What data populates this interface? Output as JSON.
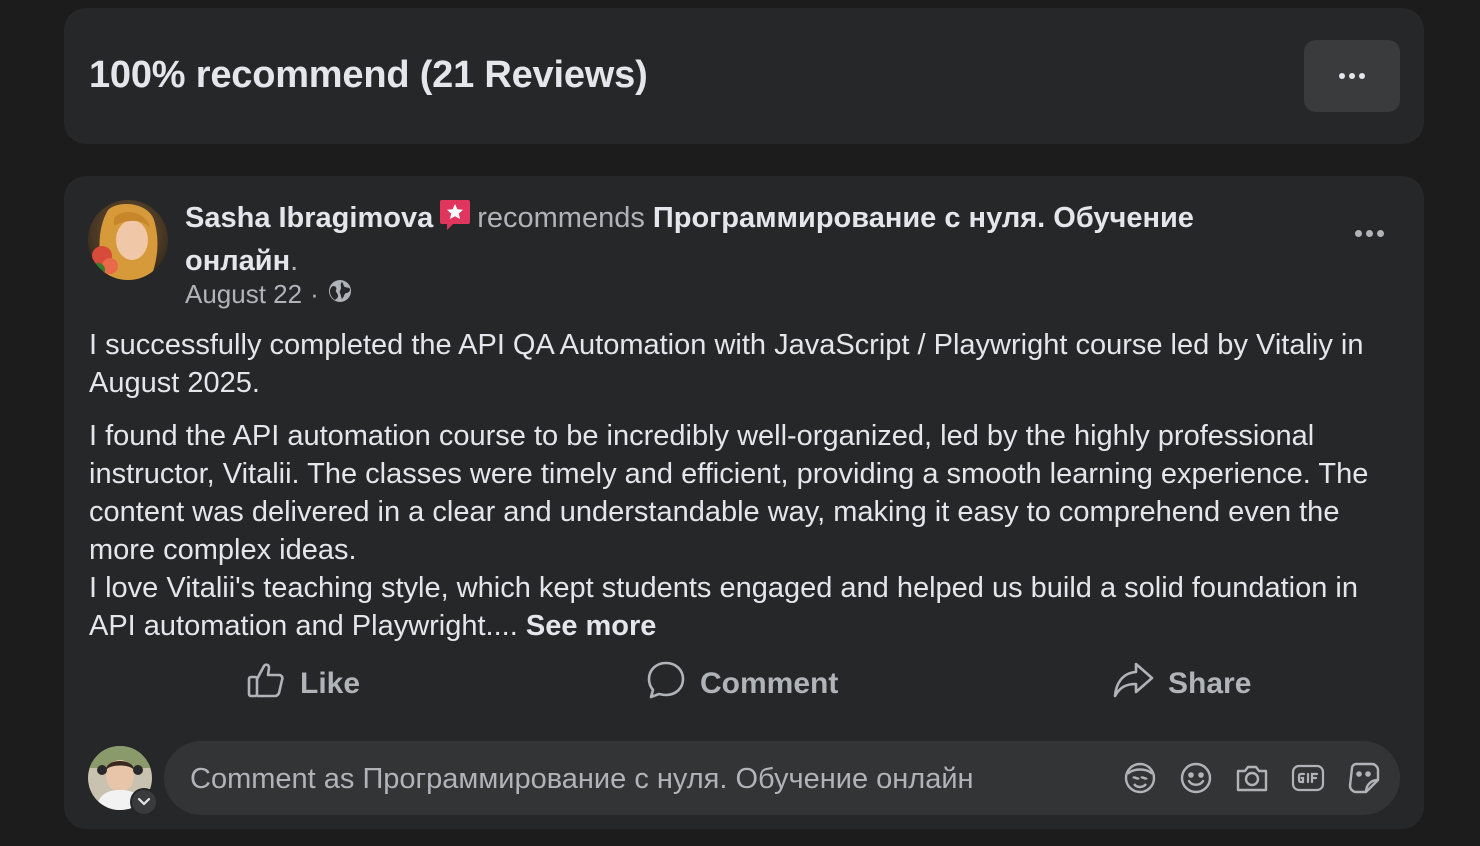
{
  "header": {
    "title": "100% recommend (21 Reviews)",
    "more_icon": "more-horizontal-icon"
  },
  "review": {
    "author": "Sasha Ibragimova",
    "badge_icon": "star-badge-icon",
    "verb": "recommends",
    "page_name": "Программирование с нуля. Обучение онлайн",
    "period": ".",
    "date": "August 22",
    "separator": "·",
    "privacy_icon": "globe-icon",
    "paragraph1": "I successfully completed the API QA Automation with JavaScript / Playwright course led by Vitaliy in August 2025.",
    "paragraph2_line1": "I found the API automation course to be incredibly well-organized, led by the highly professional instructor, Vitalii. The classes were timely and efficient, providing a smooth learning experience. The content was delivered in a clear and understandable way, making it easy to comprehend even the more complex ideas.",
    "paragraph2_line2": "I love Vitalii's teaching style, which kept students engaged and helped us build a solid foundation in API automation and Playwright....",
    "see_more": "See more"
  },
  "actions": {
    "like": "Like",
    "comment": "Comment",
    "share": "Share"
  },
  "composer": {
    "placeholder": "Comment as Программирование с нуля. Обучение онлайн",
    "icons": [
      "avatar-sticker-icon",
      "emoji-icon",
      "camera-icon",
      "gif-icon",
      "sticker-icon"
    ]
  },
  "colors": {
    "background": "#1c1c1d",
    "card": "#252728",
    "primary_text": "#e4e6eb",
    "secondary_text": "#b0b3b8",
    "badge": "#e0365d"
  }
}
